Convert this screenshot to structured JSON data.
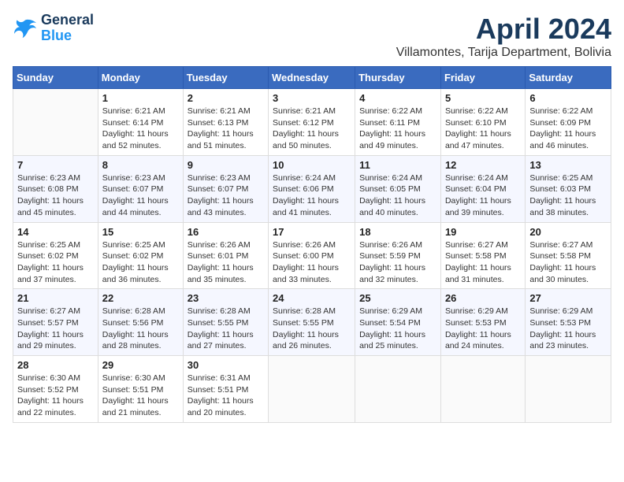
{
  "logo": {
    "line1": "General",
    "line2": "Blue"
  },
  "title": "April 2024",
  "location": "Villamontes, Tarija Department, Bolivia",
  "header": {
    "days": [
      "Sunday",
      "Monday",
      "Tuesday",
      "Wednesday",
      "Thursday",
      "Friday",
      "Saturday"
    ]
  },
  "weeks": [
    {
      "cells": [
        {
          "day": null,
          "content": null
        },
        {
          "day": "1",
          "sunrise": "6:21 AM",
          "sunset": "6:14 PM",
          "daylight": "11 hours and 52 minutes."
        },
        {
          "day": "2",
          "sunrise": "6:21 AM",
          "sunset": "6:13 PM",
          "daylight": "11 hours and 51 minutes."
        },
        {
          "day": "3",
          "sunrise": "6:21 AM",
          "sunset": "6:12 PM",
          "daylight": "11 hours and 50 minutes."
        },
        {
          "day": "4",
          "sunrise": "6:22 AM",
          "sunset": "6:11 PM",
          "daylight": "11 hours and 49 minutes."
        },
        {
          "day": "5",
          "sunrise": "6:22 AM",
          "sunset": "6:10 PM",
          "daylight": "11 hours and 47 minutes."
        },
        {
          "day": "6",
          "sunrise": "6:22 AM",
          "sunset": "6:09 PM",
          "daylight": "11 hours and 46 minutes."
        }
      ]
    },
    {
      "cells": [
        {
          "day": "7",
          "sunrise": "6:23 AM",
          "sunset": "6:08 PM",
          "daylight": "11 hours and 45 minutes."
        },
        {
          "day": "8",
          "sunrise": "6:23 AM",
          "sunset": "6:07 PM",
          "daylight": "11 hours and 44 minutes."
        },
        {
          "day": "9",
          "sunrise": "6:23 AM",
          "sunset": "6:07 PM",
          "daylight": "11 hours and 43 minutes."
        },
        {
          "day": "10",
          "sunrise": "6:24 AM",
          "sunset": "6:06 PM",
          "daylight": "11 hours and 41 minutes."
        },
        {
          "day": "11",
          "sunrise": "6:24 AM",
          "sunset": "6:05 PM",
          "daylight": "11 hours and 40 minutes."
        },
        {
          "day": "12",
          "sunrise": "6:24 AM",
          "sunset": "6:04 PM",
          "daylight": "11 hours and 39 minutes."
        },
        {
          "day": "13",
          "sunrise": "6:25 AM",
          "sunset": "6:03 PM",
          "daylight": "11 hours and 38 minutes."
        }
      ]
    },
    {
      "cells": [
        {
          "day": "14",
          "sunrise": "6:25 AM",
          "sunset": "6:02 PM",
          "daylight": "11 hours and 37 minutes."
        },
        {
          "day": "15",
          "sunrise": "6:25 AM",
          "sunset": "6:02 PM",
          "daylight": "11 hours and 36 minutes."
        },
        {
          "day": "16",
          "sunrise": "6:26 AM",
          "sunset": "6:01 PM",
          "daylight": "11 hours and 35 minutes."
        },
        {
          "day": "17",
          "sunrise": "6:26 AM",
          "sunset": "6:00 PM",
          "daylight": "11 hours and 33 minutes."
        },
        {
          "day": "18",
          "sunrise": "6:26 AM",
          "sunset": "5:59 PM",
          "daylight": "11 hours and 32 minutes."
        },
        {
          "day": "19",
          "sunrise": "6:27 AM",
          "sunset": "5:58 PM",
          "daylight": "11 hours and 31 minutes."
        },
        {
          "day": "20",
          "sunrise": "6:27 AM",
          "sunset": "5:58 PM",
          "daylight": "11 hours and 30 minutes."
        }
      ]
    },
    {
      "cells": [
        {
          "day": "21",
          "sunrise": "6:27 AM",
          "sunset": "5:57 PM",
          "daylight": "11 hours and 29 minutes."
        },
        {
          "day": "22",
          "sunrise": "6:28 AM",
          "sunset": "5:56 PM",
          "daylight": "11 hours and 28 minutes."
        },
        {
          "day": "23",
          "sunrise": "6:28 AM",
          "sunset": "5:55 PM",
          "daylight": "11 hours and 27 minutes."
        },
        {
          "day": "24",
          "sunrise": "6:28 AM",
          "sunset": "5:55 PM",
          "daylight": "11 hours and 26 minutes."
        },
        {
          "day": "25",
          "sunrise": "6:29 AM",
          "sunset": "5:54 PM",
          "daylight": "11 hours and 25 minutes."
        },
        {
          "day": "26",
          "sunrise": "6:29 AM",
          "sunset": "5:53 PM",
          "daylight": "11 hours and 24 minutes."
        },
        {
          "day": "27",
          "sunrise": "6:29 AM",
          "sunset": "5:53 PM",
          "daylight": "11 hours and 23 minutes."
        }
      ]
    },
    {
      "cells": [
        {
          "day": "28",
          "sunrise": "6:30 AM",
          "sunset": "5:52 PM",
          "daylight": "11 hours and 22 minutes."
        },
        {
          "day": "29",
          "sunrise": "6:30 AM",
          "sunset": "5:51 PM",
          "daylight": "11 hours and 21 minutes."
        },
        {
          "day": "30",
          "sunrise": "6:31 AM",
          "sunset": "5:51 PM",
          "daylight": "11 hours and 20 minutes."
        },
        {
          "day": null,
          "content": null
        },
        {
          "day": null,
          "content": null
        },
        {
          "day": null,
          "content": null
        },
        {
          "day": null,
          "content": null
        }
      ]
    }
  ]
}
